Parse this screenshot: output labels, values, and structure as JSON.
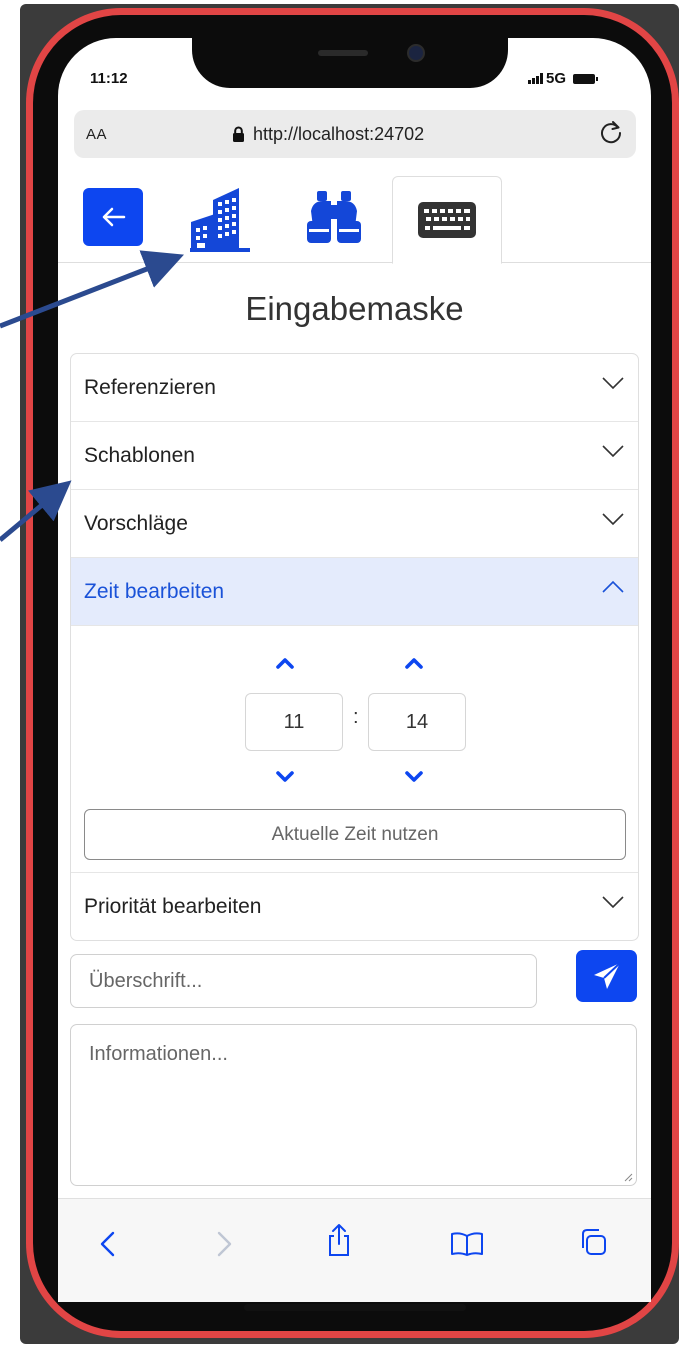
{
  "status_bar": {
    "time": "11:12",
    "network": "5G"
  },
  "browser": {
    "text_size_label": "AA",
    "url": "http://localhost:24702"
  },
  "nav_tabs": [
    {
      "icon": "arrow-left-icon",
      "active": false
    },
    {
      "icon": "building-icon",
      "active": false
    },
    {
      "icon": "binoculars-icon",
      "active": false
    },
    {
      "icon": "keyboard-icon",
      "active": true
    }
  ],
  "page_title": "Eingabemaske",
  "accordion": {
    "items": [
      {
        "label": "Referenzieren",
        "expanded": false
      },
      {
        "label": "Schablonen",
        "expanded": false
      },
      {
        "label": "Vorschläge",
        "expanded": false
      },
      {
        "label": "Zeit bearbeiten",
        "expanded": true
      },
      {
        "label": "Priorität bearbeiten",
        "expanded": false
      }
    ],
    "time_editor": {
      "hours": "11",
      "separator": ":",
      "minutes": "14",
      "now_button": "Aktuelle Zeit nutzen"
    }
  },
  "form": {
    "heading_placeholder": "Überschrift...",
    "info_placeholder": "Informationen..."
  },
  "colors": {
    "accent": "#0d46f0",
    "expanded_bg": "#e4ebfc",
    "expanded_text": "#1a52d8",
    "frame": "#e14545",
    "annotation_arrow": "#2b4a8f"
  },
  "safari_toolbar": [
    "chevron-left-icon",
    "chevron-right-icon",
    "share-icon",
    "book-icon",
    "tabs-icon"
  ]
}
